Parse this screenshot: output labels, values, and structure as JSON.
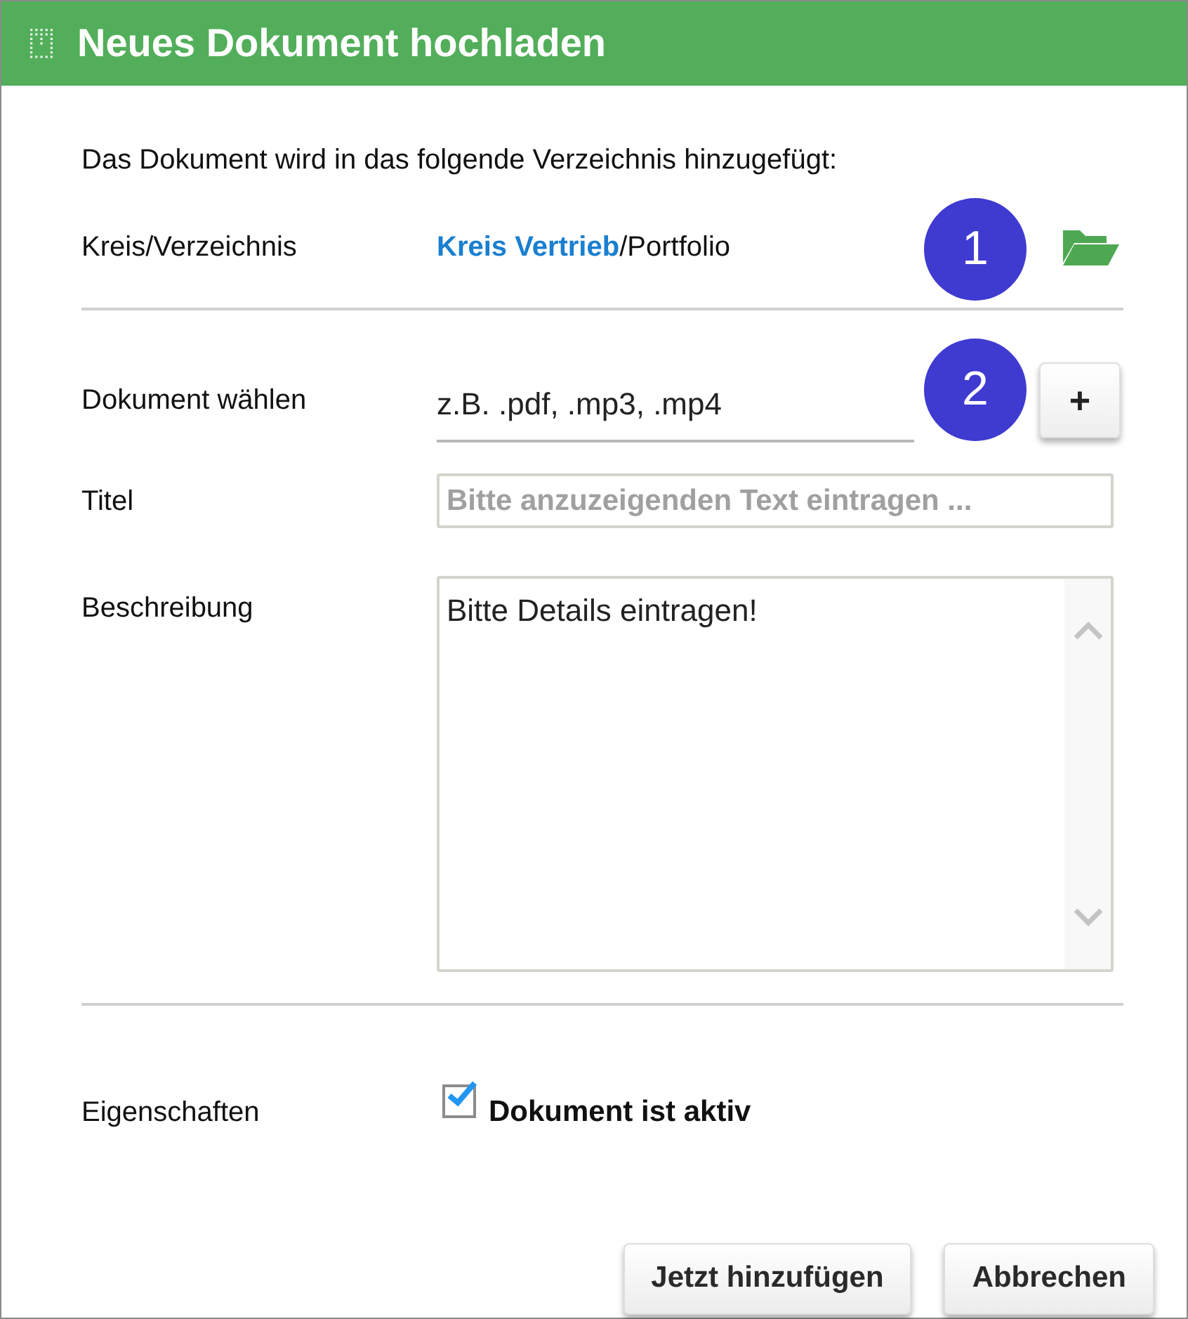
{
  "window": {
    "title": "Neues Dokument hochladen"
  },
  "intro": "Das Dokument wird in das folgende Verzeichnis hinzugefügt:",
  "location": {
    "label": "Kreis/Verzeichnis",
    "link": "Kreis Vertrieb",
    "path": "/Portfolio",
    "badge": "1"
  },
  "document": {
    "label": "Dokument wählen",
    "placeholder": "z.B. .pdf, .mp3, .mp4",
    "badge": "2",
    "add_button": "+"
  },
  "title_field": {
    "label": "Titel",
    "placeholder": "Bitte anzuzeigenden Text eintragen ..."
  },
  "description": {
    "label": "Beschreibung",
    "placeholder": "Bitte Details eintragen!"
  },
  "properties": {
    "label": "Eigenschaften",
    "checkbox": {
      "label": "Dokument ist aktiv",
      "checked": true
    }
  },
  "buttons": [
    {
      "label": "Jetzt hinzufügen"
    },
    {
      "label": "Abbrechen"
    }
  ]
}
